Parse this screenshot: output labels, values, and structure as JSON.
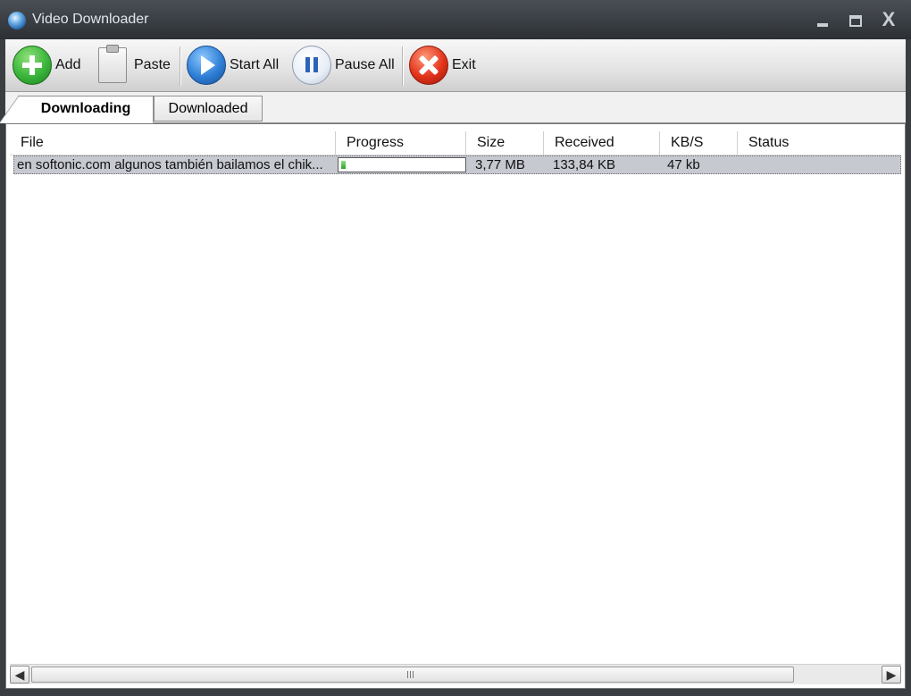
{
  "window": {
    "title": "Video Downloader",
    "close_glyph": "X"
  },
  "toolbar": {
    "add": {
      "label": "Add",
      "icon": "add-icon"
    },
    "paste": {
      "label": "Paste",
      "icon": "clipboard-icon"
    },
    "start_all": {
      "label": "Start All",
      "icon": "play-icon"
    },
    "pause_all": {
      "label": "Pause All",
      "icon": "pause-icon"
    },
    "exit": {
      "label": "Exit",
      "icon": "exit-icon"
    }
  },
  "tabs": [
    {
      "label": "Downloading",
      "active": true
    },
    {
      "label": "Downloaded",
      "active": false
    }
  ],
  "table": {
    "columns": [
      "File",
      "Progress",
      "Size",
      "Received",
      "KB/S",
      "Status"
    ],
    "rows": [
      {
        "file": "en softonic.com algunos también bailamos el chik...",
        "progress": 0.035,
        "size": "3,77 MB",
        "received": "133,84 KB",
        "speed": "47 kb",
        "status": ""
      }
    ]
  },
  "colors": {
    "progress_fill": "#27a327",
    "selected_row": "#c6c9d0",
    "titlebar": "#2c3035"
  }
}
